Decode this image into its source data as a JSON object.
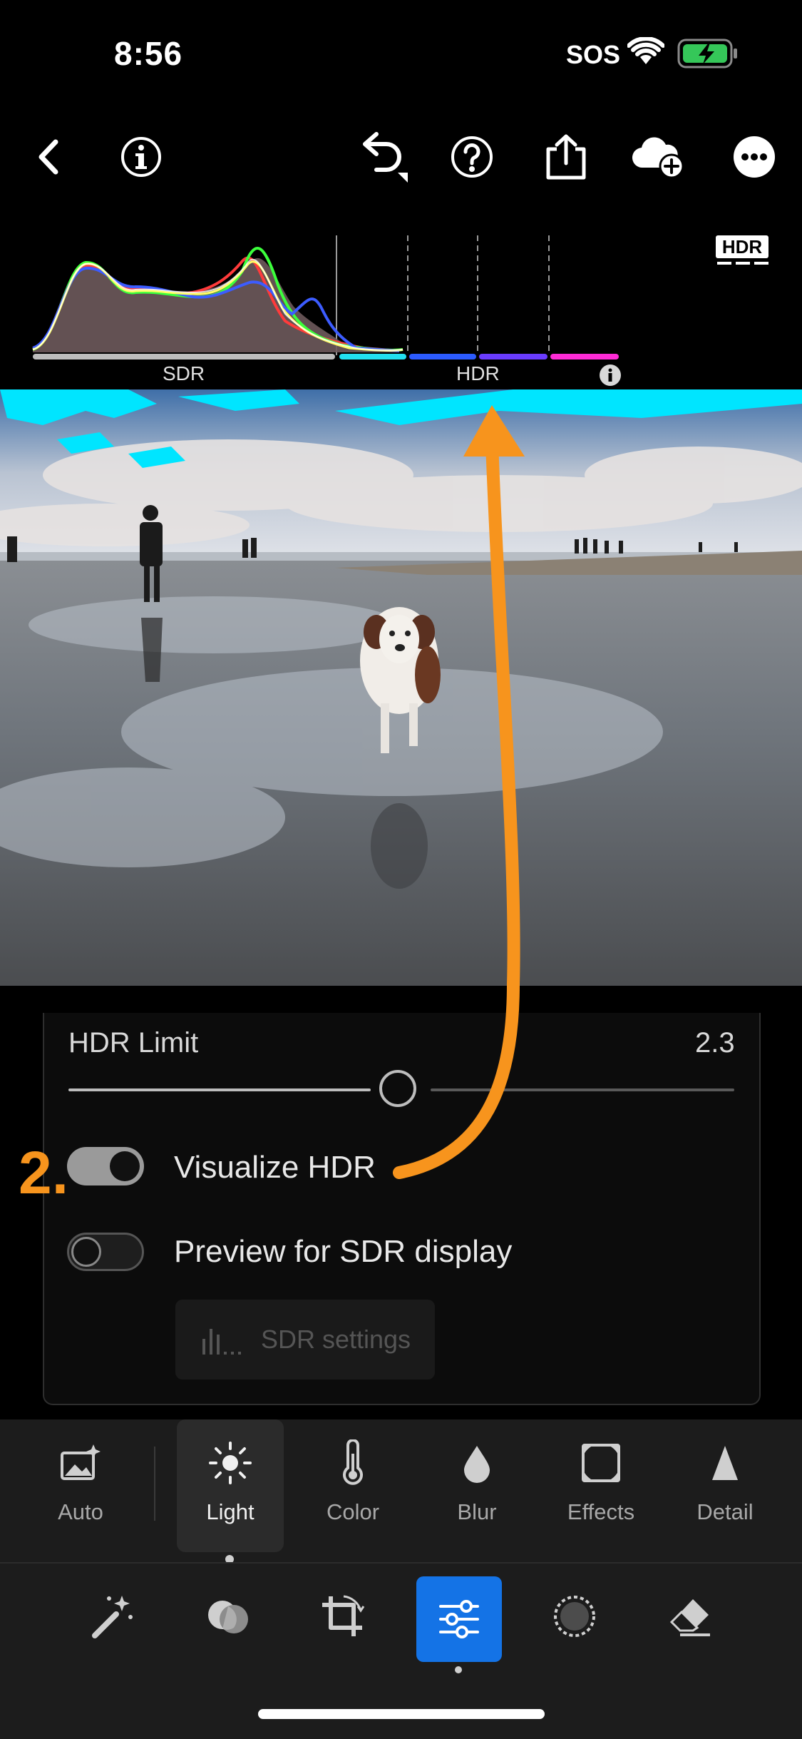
{
  "status": {
    "time": "8:56",
    "carrier": "SOS"
  },
  "toolbar": {
    "icons": [
      "back-icon",
      "info-icon",
      "undo-icon",
      "help-icon",
      "share-icon",
      "cloud-add-icon",
      "more-icon"
    ]
  },
  "histogram": {
    "sdr_label": "SDR",
    "hdr_label": "HDR",
    "badge": "HDR"
  },
  "panel": {
    "hdr_limit_label": "HDR Limit",
    "hdr_limit_value": "2.3",
    "hdr_limit_fraction": 0.5,
    "visualize_label": "Visualize HDR",
    "visualize_on": true,
    "preview_label": "Preview for SDR display",
    "preview_on": false,
    "sdr_settings_label": "SDR settings"
  },
  "annotation": {
    "step": "2.",
    "color": "#f7941d"
  },
  "edit_tools": {
    "items": [
      {
        "label": "Auto",
        "icon": "auto-image-icon"
      },
      {
        "label": "Light",
        "icon": "sun-icon",
        "active": true
      },
      {
        "label": "Color",
        "icon": "thermometer-icon"
      },
      {
        "label": "Blur",
        "icon": "drop-icon"
      },
      {
        "label": "Effects",
        "icon": "vignette-icon"
      },
      {
        "label": "Detail",
        "icon": "triangle-icon"
      }
    ]
  },
  "bottom_tools": {
    "icons": [
      "magic-wand-icon",
      "presets-icon",
      "crop-icon",
      "adjust-sliders-icon",
      "masking-icon",
      "eraser-icon"
    ],
    "active_index": 3,
    "accent": "#1473e6"
  }
}
